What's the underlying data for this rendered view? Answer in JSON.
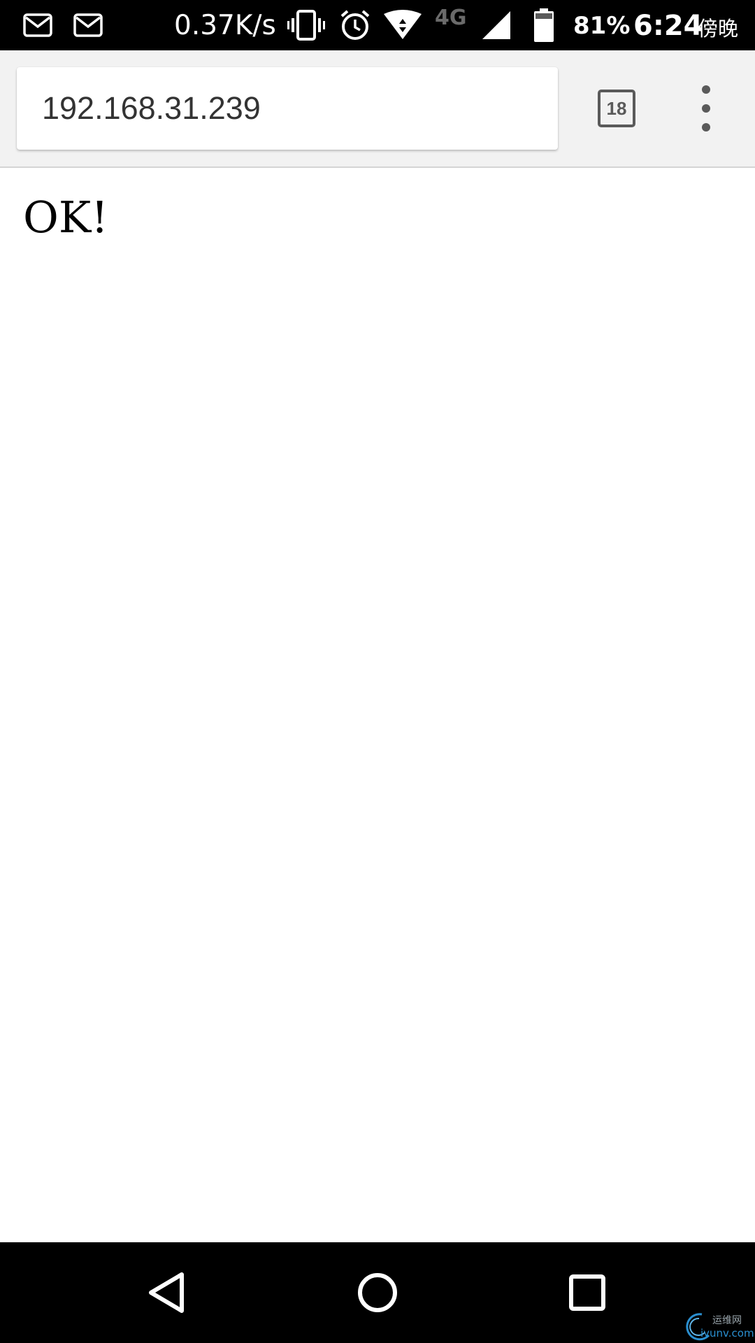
{
  "status_bar": {
    "net_speed": "0.37K/s",
    "network_type": "4G",
    "battery_percent": "81%",
    "time": "6:24",
    "period": "傍晚",
    "icons": [
      "mail-icon",
      "mail-icon",
      "vibrate-icon",
      "alarm-icon",
      "wifi-icon",
      "signal-icon",
      "battery-icon"
    ]
  },
  "browser": {
    "url": "192.168.31.239",
    "tab_count": "18"
  },
  "page": {
    "body_text": "OK!"
  },
  "nav_bar": {
    "icons": [
      "back-icon",
      "home-icon",
      "recents-icon"
    ]
  },
  "watermark": {
    "text": "运维网",
    "domain": "iyunv.com"
  },
  "colors": {
    "status_bar_bg": "#000000",
    "toolbar_bg": "#f2f2f2",
    "toolbar_icon": "#5a5a5a",
    "url_text": "#333333",
    "page_bg": "#ffffff"
  }
}
